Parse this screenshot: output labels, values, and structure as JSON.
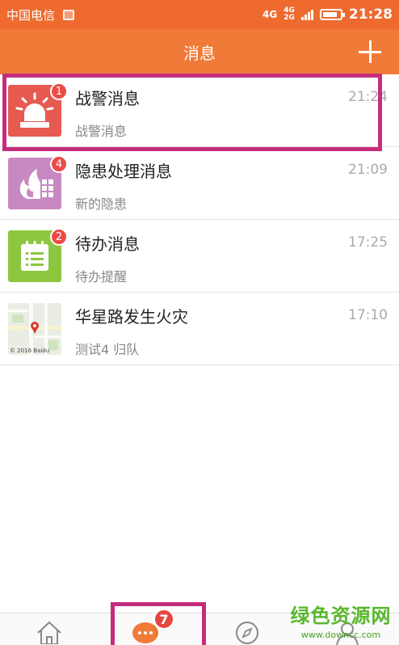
{
  "status_bar": {
    "carrier": "中国电信",
    "network_primary": "4G",
    "network_secondary_top": "4G",
    "network_secondary_bottom": "2G",
    "time": "21:28"
  },
  "header": {
    "title": "消息",
    "add_icon": "plus-icon"
  },
  "messages": [
    {
      "title": "战警消息",
      "subtitle": "战警消息",
      "time": "21:24",
      "badge": "1",
      "icon": "siren-icon",
      "icon_bg": "#e65a50"
    },
    {
      "title": "隐患处理消息",
      "subtitle": "新的隐患",
      "time": "21:09",
      "badge": "4",
      "icon": "fire-hazard-icon",
      "icon_bg": "#c889c2"
    },
    {
      "title": "待办消息",
      "subtitle": "待办提醒",
      "time": "17:25",
      "badge": "2",
      "icon": "calendar-list-icon",
      "icon_bg": "#8dc63f"
    },
    {
      "title": "华星路发生火灾",
      "subtitle": "测试4 归队",
      "time": "17:10",
      "icon": "map-thumbnail",
      "map_copyright": "© 2016 Baidu"
    }
  ],
  "tab_bar": {
    "tabs": [
      {
        "name": "home",
        "icon": "home-icon"
      },
      {
        "name": "messages",
        "icon": "chat-bubble-icon",
        "badge": "7"
      },
      {
        "name": "discover",
        "icon": "compass-icon"
      },
      {
        "name": "profile",
        "icon": "user-icon"
      }
    ]
  },
  "watermark": {
    "title": "绿色资源网",
    "url": "www.downcc.com"
  },
  "colors": {
    "status_bar": "#ee6a2e",
    "header": "#f07a38",
    "badge": "#ea4b44",
    "highlight": "#c42d7c"
  }
}
